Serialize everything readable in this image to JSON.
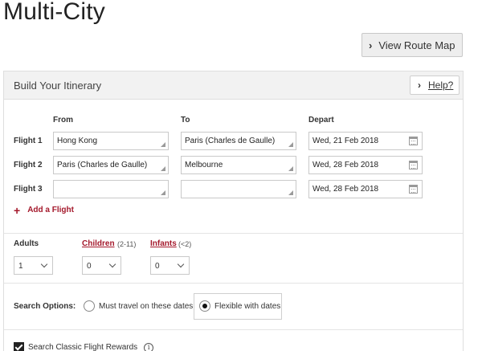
{
  "page": {
    "title": "Multi-City"
  },
  "header": {
    "route_map_label": "View Route Map"
  },
  "itinerary": {
    "title": "Build Your Itinerary",
    "help_label": "Help?",
    "columns": {
      "from": "From",
      "to": "To",
      "depart": "Depart"
    },
    "flights": [
      {
        "label": "Flight 1",
        "from": "Hong Kong",
        "to": "Paris (Charles de Gaulle)",
        "depart": "Wed, 21 Feb 2018"
      },
      {
        "label": "Flight 2",
        "from": "Paris (Charles de Gaulle)",
        "to": "Melbourne",
        "depart": "Wed, 28 Feb 2018"
      },
      {
        "label": "Flight 3",
        "from": "",
        "to": "",
        "depart": "Wed, 28 Feb 2018"
      }
    ],
    "add_flight_label": "Add a Flight"
  },
  "passengers": {
    "adults": {
      "label": "Adults",
      "value": "1"
    },
    "children": {
      "label": "Children",
      "hint": "(2-11)",
      "value": "0"
    },
    "infants": {
      "label": "Infants",
      "hint": "(<2)",
      "value": "0"
    }
  },
  "search_options": {
    "label": "Search Options:",
    "options": [
      {
        "label": "Must travel on these dates",
        "selected": false
      },
      {
        "label": "Flexible with dates",
        "selected": true
      }
    ]
  },
  "rewards": {
    "label": "Search Classic Flight Rewards",
    "checked": true
  },
  "colors": {
    "accent": "#a4182b",
    "panel_header_bg": "#f2f2f2"
  }
}
